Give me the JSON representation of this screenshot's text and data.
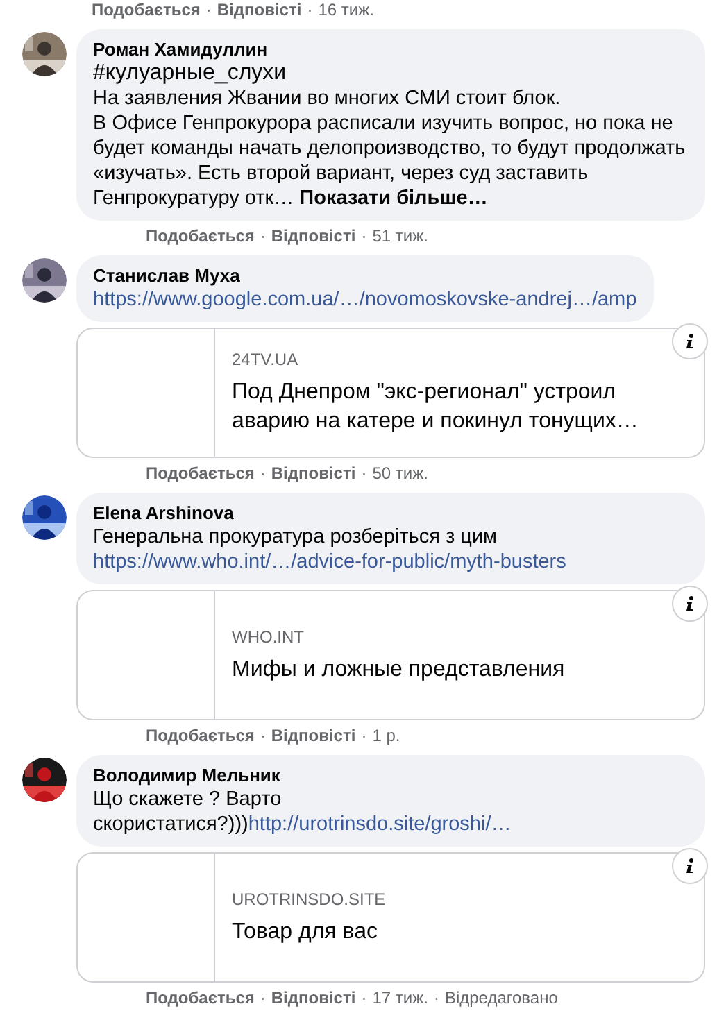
{
  "top_meta": [
    {
      "kind": "action",
      "label": "Подобається"
    },
    {
      "kind": "dot",
      "label": "·"
    },
    {
      "kind": "action",
      "label": "Відповісті"
    },
    {
      "kind": "dot",
      "label": "·"
    },
    {
      "kind": "time",
      "label": "16 тиж."
    }
  ],
  "comments": [
    {
      "author": "Роман Хамидуллин",
      "paragraphs": [
        [
          {
            "kind": "hashtag",
            "text": "#кулуарные_слухи"
          }
        ],
        [
          {
            "kind": "text",
            "text": "На заявления Жвании во многих СМИ стоит блок."
          }
        ],
        [
          {
            "kind": "text",
            "text": "В Офисе Генпрокурора расписали изучить вопрос, но пока не будет команды начать делопроизводство, то будут продолжать «изучать». Есть второй вариант, через суд заставить Генпрокуратуру отк… "
          },
          {
            "kind": "more",
            "text": "Показати більше…"
          }
        ]
      ],
      "meta": [
        {
          "kind": "action",
          "label": "Подобається"
        },
        {
          "kind": "dot",
          "label": "·"
        },
        {
          "kind": "action",
          "label": "Відповісті"
        },
        {
          "kind": "dot",
          "label": "·"
        },
        {
          "kind": "time",
          "label": "51 тиж."
        }
      ]
    },
    {
      "author": "Станислав Муха",
      "paragraphs": [
        [
          {
            "kind": "link",
            "text": "https://www.google.com.ua/…/novomoskovske-andrej…/amp"
          }
        ]
      ],
      "preview": {
        "domain": "24TV.UA",
        "title": "Под Днепром \"экс-регионал\" устроил аварию на катере и покинул тонущих…"
      },
      "meta": [
        {
          "kind": "action",
          "label": "Подобається"
        },
        {
          "kind": "dot",
          "label": "·"
        },
        {
          "kind": "action",
          "label": "Відповісті"
        },
        {
          "kind": "dot",
          "label": "·"
        },
        {
          "kind": "time",
          "label": "50 тиж."
        }
      ]
    },
    {
      "author": "Elena Arshinova",
      "paragraphs": [
        [
          {
            "kind": "text",
            "text": "Генеральна прокуратура розберіться з цим"
          }
        ],
        [
          {
            "kind": "link",
            "text": "https://www.who.int/…/advice-for-public/myth-busters"
          }
        ]
      ],
      "preview": {
        "domain": "WHO.INT",
        "title": "Мифы и ложные представления"
      },
      "meta": [
        {
          "kind": "action",
          "label": "Подобається"
        },
        {
          "kind": "dot",
          "label": "·"
        },
        {
          "kind": "action",
          "label": "Відповісті"
        },
        {
          "kind": "dot",
          "label": "·"
        },
        {
          "kind": "time",
          "label": "1 р."
        }
      ]
    },
    {
      "author": "Володимир Мельник",
      "paragraphs": [
        [
          {
            "kind": "text",
            "text": "Що скажете ? Варто скористатися?)))"
          },
          {
            "kind": "link",
            "text": "http://urotrinsdo.site/groshi/…"
          }
        ]
      ],
      "preview": {
        "domain": "UROTRINSDO.SITE",
        "title": "Товар для вас"
      },
      "meta": [
        {
          "kind": "action",
          "label": "Подобається"
        },
        {
          "kind": "dot",
          "label": "·"
        },
        {
          "kind": "action",
          "label": "Відповісті"
        },
        {
          "kind": "dot",
          "label": "·"
        },
        {
          "kind": "time",
          "label": "17 тиж."
        },
        {
          "kind": "dot",
          "label": "·"
        },
        {
          "kind": "time",
          "label": "Відредаговано"
        }
      ]
    }
  ]
}
